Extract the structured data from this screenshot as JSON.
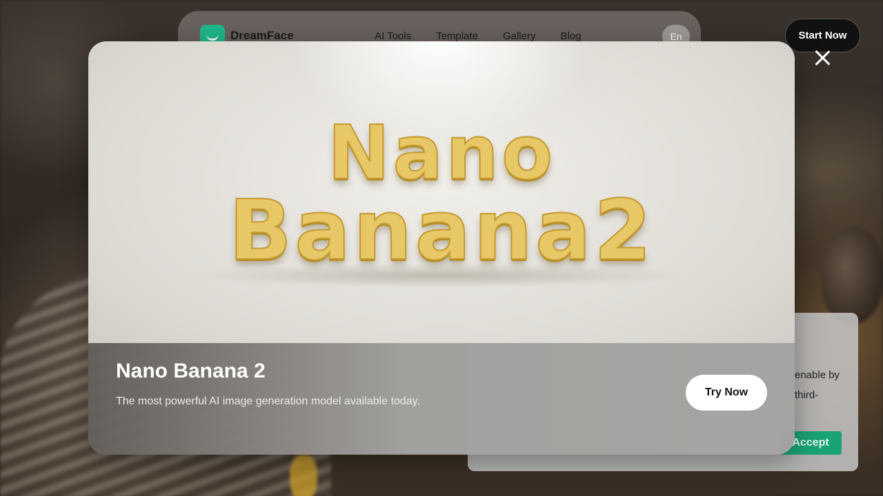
{
  "nav": {
    "brand": "DreamFace",
    "links": [
      "AI Tools",
      "Template",
      "Gallery",
      "Blog"
    ],
    "language": "En",
    "cta": "Start Now"
  },
  "cookie_banner": {
    "text": "enable by third-",
    "accept_label": "Accept"
  },
  "modal": {
    "hero_line1": "Nano",
    "hero_line2": "Banana2",
    "title": "Nano Banana 2",
    "subtitle": "The most powerful AI image generation model available today.",
    "try_label": "Try Now",
    "close_icon": "close-icon"
  },
  "colors": {
    "brand_green": "#1fb689",
    "accept_green": "#1aa374",
    "cta_dark": "#111111",
    "banana_yellow": "#e8c766"
  }
}
